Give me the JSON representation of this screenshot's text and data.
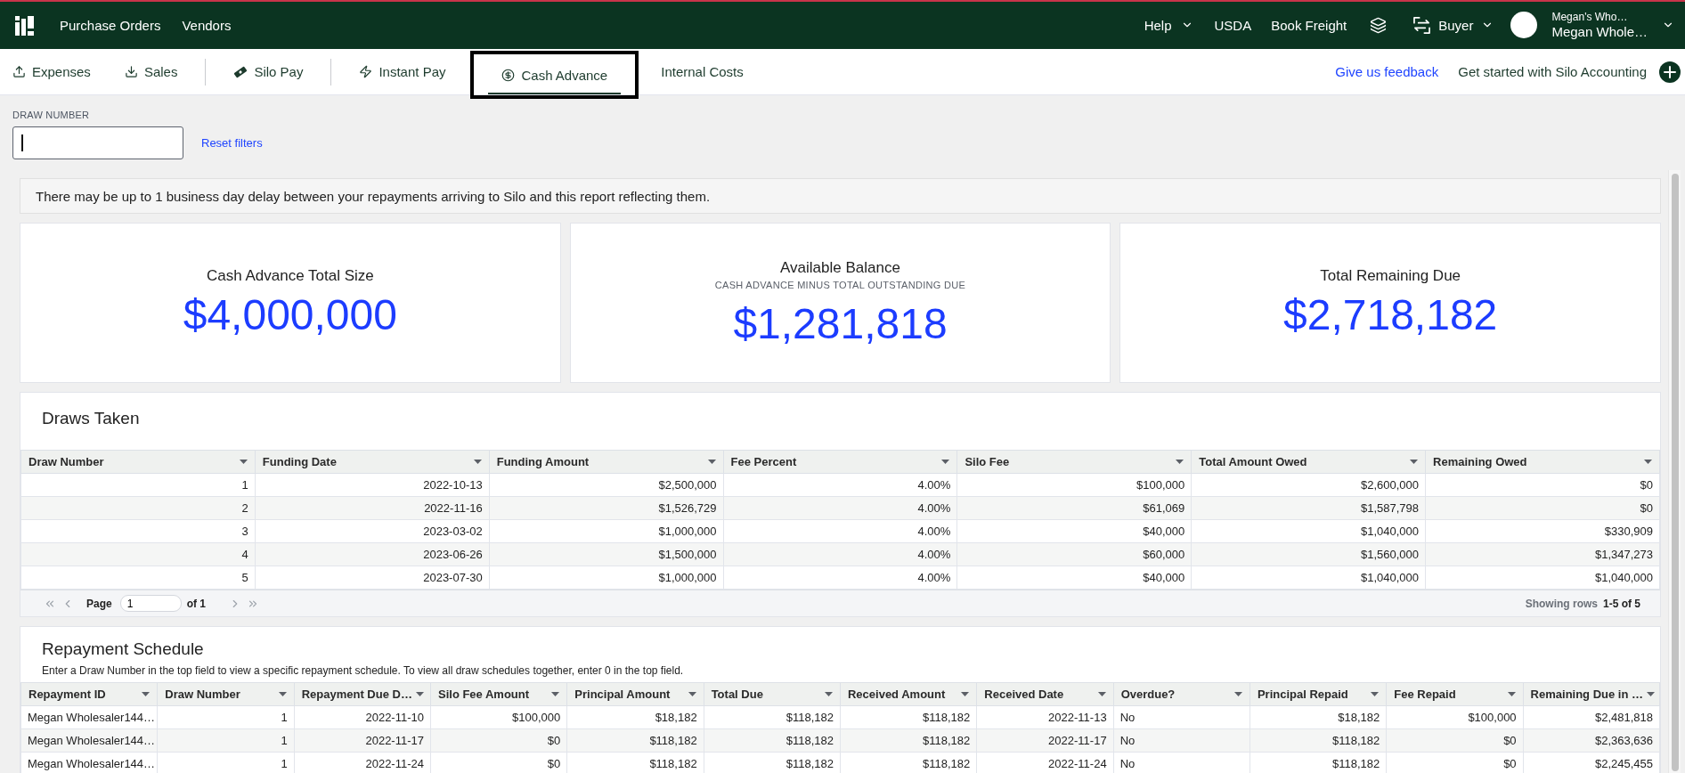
{
  "top_nav": {
    "links": [
      {
        "label": "Purchase Orders"
      },
      {
        "label": "Vendors"
      }
    ],
    "help": "Help",
    "usda": "USDA",
    "book_freight": "Book Freight",
    "role": "Buyer",
    "account": {
      "company": "Megan's Who…",
      "user": "Megan Whole…"
    }
  },
  "sub_nav": {
    "tab_groups": [
      {
        "tabs": [
          {
            "label": "Expenses",
            "selected": false,
            "focused": false
          },
          {
            "label": "Sales",
            "selected": false,
            "focused": false
          }
        ]
      },
      {
        "tabs": [
          {
            "label": "Silo Pay",
            "selected": false,
            "focused": false
          }
        ]
      },
      {
        "tabs": [
          {
            "label": "Instant Pay",
            "selected": false,
            "focused": false
          }
        ]
      },
      {
        "tabs": [
          {
            "label": "Cash Advance",
            "selected": true,
            "focused": true
          },
          {
            "label": "Internal Costs",
            "selected": false,
            "focused": false
          }
        ]
      }
    ],
    "feedback_link": "Give us feedback",
    "accounting_cta": "Get started with Silo Accounting"
  },
  "filters": {
    "draw_number": {
      "label": "DRAW NUMBER",
      "focused": true
    },
    "reset": "Reset filters"
  },
  "notice": "There may be up to 1 business day delay between your repayments arriving to Silo and this report reflecting them.",
  "metrics": [
    {
      "title": "Cash Advance Total Size",
      "value": "$4,000,000"
    },
    {
      "title": "Available Balance",
      "subtitle": "CASH ADVANCE MINUS TOTAL OUTSTANDING DUE",
      "value": "$1,281,818"
    },
    {
      "title": "Total Remaining Due",
      "value": "$2,718,182"
    }
  ],
  "draws_taken": {
    "title": "Draws Taken",
    "columns": [
      {
        "label": "Draw Number",
        "kind": "number"
      },
      {
        "label": "Funding Date",
        "kind": "number"
      },
      {
        "label": "Funding Amount",
        "kind": "number"
      },
      {
        "label": "Fee Percent",
        "kind": "number"
      },
      {
        "label": "Silo Fee",
        "kind": "number"
      },
      {
        "label": "Total Amount Owed",
        "kind": "number"
      },
      {
        "label": "Remaining Owed",
        "kind": "number"
      }
    ],
    "rows": [
      [
        "1",
        "2022-10-13",
        "$2,500,000",
        "4.00%",
        "$100,000",
        "$2,600,000",
        "$0"
      ],
      [
        "2",
        "2022-11-16",
        "$1,526,729",
        "4.00%",
        "$61,069",
        "$1,587,798",
        "$0"
      ],
      [
        "3",
        "2023-03-02",
        "$1,000,000",
        "4.00%",
        "$40,000",
        "$1,040,000",
        "$330,909"
      ],
      [
        "4",
        "2023-06-26",
        "$1,500,000",
        "4.00%",
        "$60,000",
        "$1,560,000",
        "$1,347,273"
      ],
      [
        "5",
        "2023-07-30",
        "$1,000,000",
        "4.00%",
        "$40,000",
        "$1,040,000",
        "$1,040,000"
      ]
    ],
    "pagination": {
      "page_label": "Page",
      "page": "1",
      "total": "of 1",
      "rows_label": "Showing rows",
      "rows": "1-5 of 5"
    }
  },
  "repayment_schedule": {
    "title": "Repayment Schedule",
    "description": "Enter a Draw Number in the top field to view a specific repayment schedule. To view all draw schedules together, enter 0 in the top field.",
    "columns": [
      {
        "label": "Repayment ID",
        "kind": "text"
      },
      {
        "label": "Draw Number",
        "kind": "number"
      },
      {
        "label": "Repayment Due D…",
        "kind": "number"
      },
      {
        "label": "Silo Fee Amount",
        "kind": "number"
      },
      {
        "label": "Principal Amount",
        "kind": "number"
      },
      {
        "label": "Total Due",
        "kind": "number"
      },
      {
        "label": "Received Amount",
        "kind": "number"
      },
      {
        "label": "Received Date",
        "kind": "number"
      },
      {
        "label": "Overdue?",
        "kind": "text"
      },
      {
        "label": "Principal Repaid",
        "kind": "number"
      },
      {
        "label": "Fee Repaid",
        "kind": "number"
      },
      {
        "label": "Remaining Due in …",
        "kind": "number"
      }
    ],
    "rows": [
      [
        "Megan Wholesaler144…",
        "1",
        "2022-11-10",
        "$100,000",
        "$18,182",
        "$118,182",
        "$118,182",
        "2022-11-13",
        "No",
        "$18,182",
        "$100,000",
        "$2,481,818"
      ],
      [
        "Megan Wholesaler144…",
        "1",
        "2022-11-17",
        "$0",
        "$118,182",
        "$118,182",
        "$118,182",
        "2022-11-17",
        "No",
        "$118,182",
        "$0",
        "$2,363,636"
      ],
      [
        "Megan Wholesaler144…",
        "1",
        "2022-11-24",
        "$0",
        "$118,182",
        "$118,182",
        "$118,182",
        "2022-11-24",
        "No",
        "$118,182",
        "$0",
        "$2,245,455"
      ]
    ]
  }
}
